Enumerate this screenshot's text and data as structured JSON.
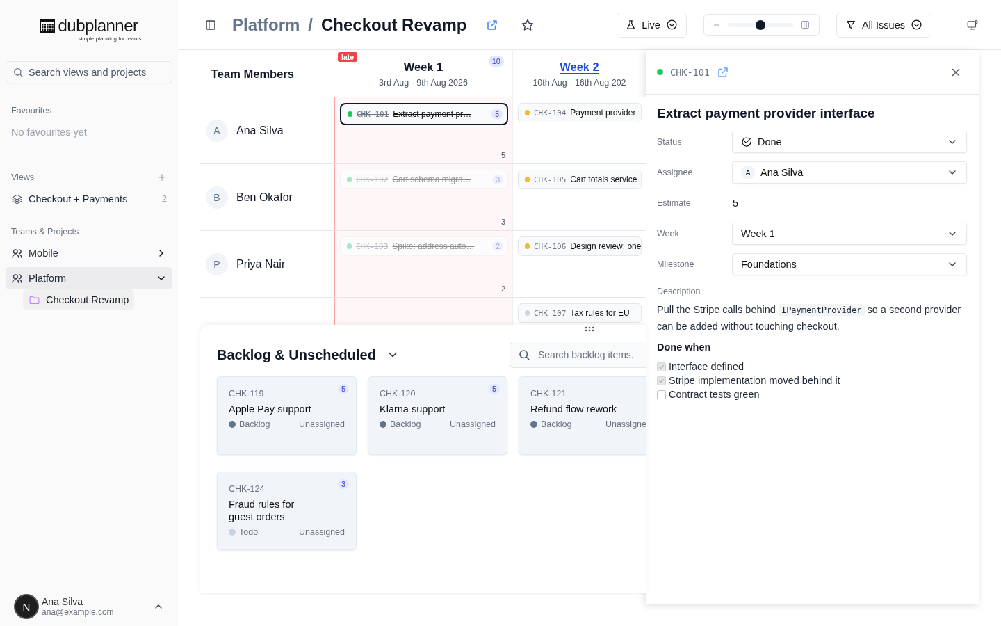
{
  "app": {
    "logo": "dubplanner",
    "tagline": "simple planning for teams"
  },
  "sidebar": {
    "search": {
      "placeholder": "Search views and projects"
    },
    "favourites": {
      "heading": "Favourites",
      "empty": "No favourites yet"
    },
    "views": {
      "heading": "Views",
      "items": [
        {
          "label": "Checkout + Payments",
          "count": "2"
        }
      ]
    },
    "teams": {
      "heading": "Teams & Projects",
      "items": [
        {
          "label": "Mobile",
          "expanded": false,
          "selected": false
        },
        {
          "label": "Platform",
          "expanded": true,
          "selected": true,
          "children": [
            {
              "label": "Checkout Revamp",
              "selected": true
            }
          ]
        }
      ]
    },
    "user": {
      "initial": "N",
      "name": "Ana Silva",
      "email": "ana@example.com"
    }
  },
  "header": {
    "parent": "Platform",
    "separator": "/",
    "current": "Checkout Revamp",
    "starred": false,
    "mode": {
      "label": "Live"
    },
    "zoom": {
      "level": 0.5
    },
    "filter": {
      "label": "All Issues"
    }
  },
  "board": {
    "members_heading": "Team Members",
    "weeks": [
      {
        "title": "Week 1",
        "dates": "3rd Aug - 9th Aug 2026",
        "badge": "late",
        "count": "10",
        "late": true,
        "current": false
      },
      {
        "title": "Week 2",
        "dates": "10th Aug - 16th Aug 202",
        "late": false,
        "current": true
      }
    ],
    "rows": [
      {
        "member": {
          "initial": "A",
          "name": "Ana Silva"
        },
        "cells": [
          {
            "total": "5",
            "cards": [
              {
                "id": "CHK-101",
                "title": "Extract payment pr…",
                "points": "5",
                "done": true,
                "color": "#22c55e",
                "selected": true,
                "dimmed": false
              }
            ]
          },
          {
            "cards": [
              {
                "id": "CHK-104",
                "title": "Payment provider",
                "done": false,
                "color": "#f5b82e",
                "selected": false,
                "dimmed": false
              }
            ]
          }
        ]
      },
      {
        "member": {
          "initial": "B",
          "name": "Ben Okafor"
        },
        "cells": [
          {
            "total": "3",
            "cards": [
              {
                "id": "CHK-102",
                "title": "Cart schema migra…",
                "points": "3",
                "done": true,
                "color": "#a7e9bd",
                "selected": false,
                "dimmed": true
              }
            ]
          },
          {
            "cards": [
              {
                "id": "CHK-105",
                "title": "Cart totals service",
                "done": false,
                "color": "#f5b82e",
                "selected": false,
                "dimmed": false
              }
            ]
          }
        ]
      },
      {
        "member": {
          "initial": "P",
          "name": "Priya Nair"
        },
        "cells": [
          {
            "total": "2",
            "cards": [
              {
                "id": "CHK-103",
                "title": "Spike: address auto…",
                "points": "2",
                "done": true,
                "color": "#a7e9bd",
                "selected": false,
                "dimmed": true
              }
            ]
          },
          {
            "cards": [
              {
                "id": "CHK-106",
                "title": "Design review: one",
                "done": false,
                "color": "#f5b82e",
                "selected": false,
                "dimmed": false
              }
            ]
          }
        ]
      },
      {
        "cells": [
          {},
          {
            "cards": [
              {
                "id": "CHK-107",
                "title": "Tax rules for EU",
                "done": false,
                "color": "#cbd5e1",
                "selected": false,
                "dimmed": false
              }
            ]
          }
        ]
      }
    ]
  },
  "backlog": {
    "title": "Backlog & Unscheduled",
    "expanded": true,
    "search": {
      "placeholder": "Search backlog items."
    },
    "cards": [
      {
        "id": "CHK-119",
        "title": "Apple Pay support",
        "points": "5",
        "status": "Backlog",
        "color": "#64748b",
        "assignee": "Unassigned"
      },
      {
        "id": "CHK-120",
        "title": "Klarna support",
        "points": "5",
        "status": "Backlog",
        "color": "#64748b",
        "assignee": "Unassigned"
      },
      {
        "id": "CHK-121",
        "title": "Refund flow rework",
        "status": "Backlog",
        "color": "#64748b",
        "assignee": "Unassigne"
      },
      {
        "id": "CHK-124",
        "title": "Fraud rules for guest orders",
        "points": "3",
        "status": "Todo",
        "color": "#cbd5e1",
        "assignee": "Unassigned"
      }
    ]
  },
  "detail": {
    "id": "CHK-101",
    "color": "#22c55e",
    "title": "Extract payment provider interface",
    "fields": [
      {
        "label": "Status",
        "kind": "status",
        "value": "Done"
      },
      {
        "label": "Assignee",
        "kind": "person",
        "initial": "A",
        "value": "Ana Silva"
      },
      {
        "label": "Estimate",
        "kind": "text",
        "value": "5"
      },
      {
        "label": "Week",
        "kind": "select",
        "value": "Week 1"
      },
      {
        "label": "Milestone",
        "kind": "select",
        "value": "Foundations"
      }
    ],
    "description_label": "Description",
    "description": [
      {
        "kind": "text",
        "text": "Pull the Stripe calls behind "
      },
      {
        "kind": "code",
        "text": "IPaymentProvider"
      },
      {
        "kind": "text",
        "text": " so a second provider can be added without touching checkout."
      }
    ],
    "checklist_title": "Done when",
    "checklist": [
      {
        "label": "Interface defined",
        "checked": true
      },
      {
        "label": "Stripe implementation moved behind it",
        "checked": true
      },
      {
        "label": "Contract tests green",
        "checked": false
      }
    ]
  }
}
